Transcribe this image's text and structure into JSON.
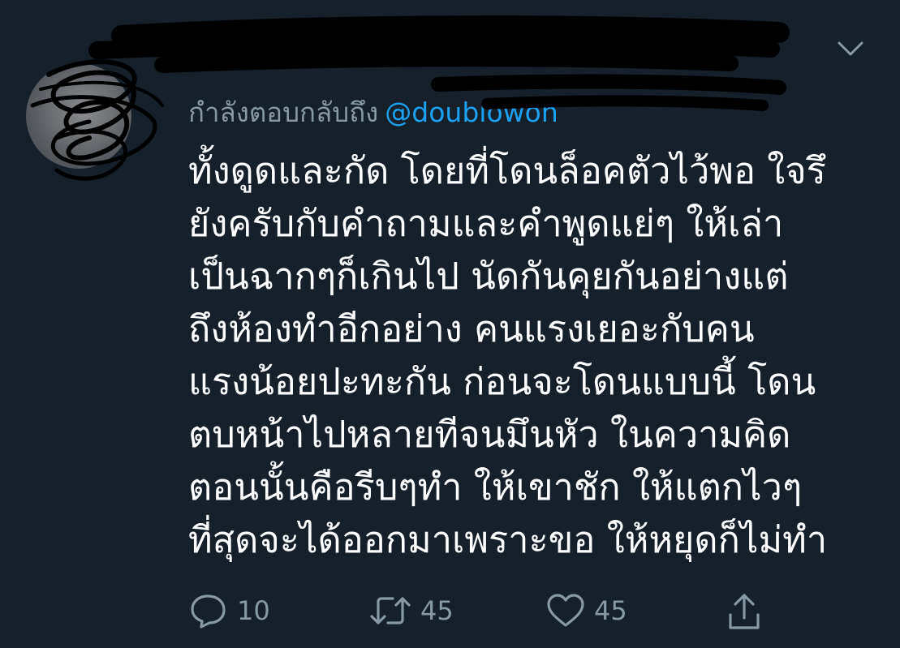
{
  "tweet": {
    "reply_prefix": "กำลังตอบกลับถึง",
    "reply_handle": "@doublowon",
    "body_lines": [
      "ทั้งดูดและกัด โดยที่โดนล็อคตัวไว้พอ ใจรึ",
      "ยังครับกับคำถามและคำพูดแย่ๆ ให้เล่า",
      "เป็นฉากๆก็เกินไป นัดกันคุยกันอย่างแต่",
      "ถึงห้องทำอีกอย่าง คนแรงเยอะกับคน",
      "แรงน้อยปะทะกัน ก่อนจะโดนแบบนี้ โดน",
      "ตบหน้าไปหลายทีจนมึนหัว ในความคิด",
      "ตอนนั้นคือรีบๆทำ ให้เขาชัก ให้แตกไวๆ",
      "ที่สุดจะได้ออกมาเพราะขอ ให้หยุดก็ไม่ทำ"
    ],
    "actions": {
      "reply_count": "10",
      "retweet_count": "45",
      "like_count": "45"
    }
  },
  "colors": {
    "background": "#15202b",
    "text": "#ffffff",
    "secondary": "#8899a6",
    "link": "#1da1f2"
  },
  "icons": [
    "avatar",
    "chevron-down-icon",
    "reply-icon",
    "retweet-icon",
    "like-icon",
    "share-icon"
  ]
}
